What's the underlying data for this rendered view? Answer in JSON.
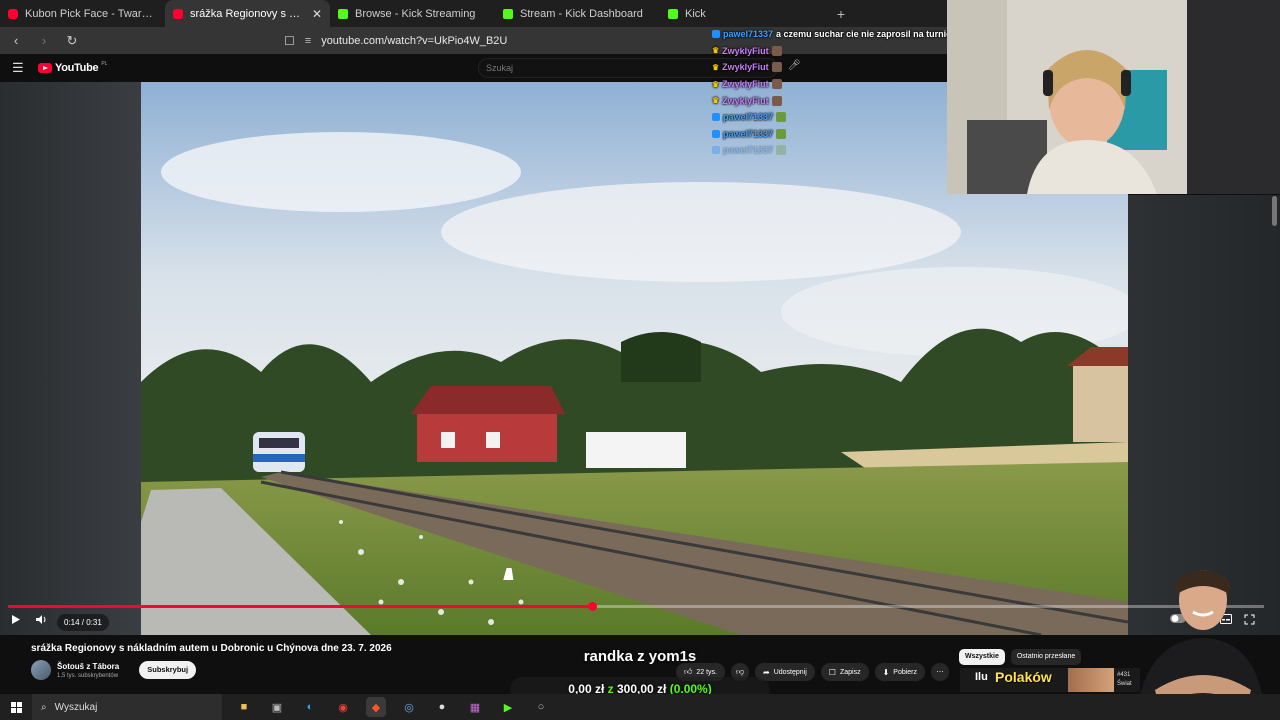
{
  "browser": {
    "tabs": [
      {
        "title": "Kubon Pick Face - Twarz Kubona pod",
        "favicon": "youtube",
        "active": false
      },
      {
        "title": "srážka Regionovy s nákladním au",
        "favicon": "youtube",
        "active": true
      },
      {
        "title": "Browse - Kick Streaming",
        "favicon": "kick",
        "active": false
      },
      {
        "title": "Stream - Kick Dashboard",
        "favicon": "kick",
        "active": false
      },
      {
        "title": "Kick",
        "favicon": "kick",
        "active": false
      }
    ],
    "close_tab_glyph": "✕",
    "new_tab_glyph": "+",
    "url": "youtube.com/watch?v=UkPio4W_B2U"
  },
  "youtube": {
    "logo_text": "YouTube",
    "region": "PL",
    "search_placeholder": "Szukaj",
    "video": {
      "title": "srážka Regionovy s nákladním autem u Dobronic u Chýnova dne 23. 7. 2026",
      "time_current": "0:14",
      "time_total": "0:31",
      "time_display": "0:14 / 0:31",
      "progress_fraction": 0.465
    },
    "channel": {
      "name": "Šotouš z Tábora",
      "subscribers": "1,5 tys. subskrybentów",
      "subscribe_label": "Subskrybuj"
    },
    "actions": {
      "likes": "22 tys.",
      "share": "Udostępnij",
      "save": "Zapisz",
      "download": "Pobierz",
      "more": "⋯"
    },
    "filter_chips": [
      "Wszystkie",
      "Ostatnio przesłane"
    ],
    "recommendation": {
      "thumb_text_1": "Ilu",
      "thumb_text_2": "Polaków",
      "meta_1": "#431",
      "meta_2": "Świat"
    }
  },
  "chat": [
    {
      "user": "pawel71337",
      "text": "a czemu suchar cie nie zaprosil na turnie",
      "style": "blue"
    },
    {
      "user": "ZwyklyFiut",
      "text": "",
      "style": "crown"
    },
    {
      "user": "ZwyklyFiut",
      "text": "",
      "style": "crown"
    },
    {
      "user": "ZwyklyFiut",
      "text": "",
      "style": "crown"
    },
    {
      "user": "ZwyklyFiut",
      "text": "",
      "style": "crown"
    },
    {
      "user": "pawel71337",
      "text": "",
      "style": "blue"
    },
    {
      "user": "pawel71337",
      "text": "",
      "style": "blue"
    },
    {
      "user": "pawel71337",
      "text": "",
      "style": "blue-faded"
    }
  ],
  "stream_goal": {
    "title": "randka z yom1s",
    "current": "0,00 zł",
    "joiner": "z",
    "target": "300,00 zł",
    "percent": "(0.00%)"
  },
  "taskbar": {
    "search_label": "Wyszukaj",
    "icons": [
      "file-explorer",
      "store",
      "edge",
      "chrome",
      "brave",
      "steam",
      "obs",
      "discord-like",
      "kick",
      "app"
    ]
  },
  "colors": {
    "yt_red": "#ff0033",
    "kick_green": "#53fc18",
    "chat_blue": "#3fa1ff",
    "chat_purple": "#c77dff"
  }
}
